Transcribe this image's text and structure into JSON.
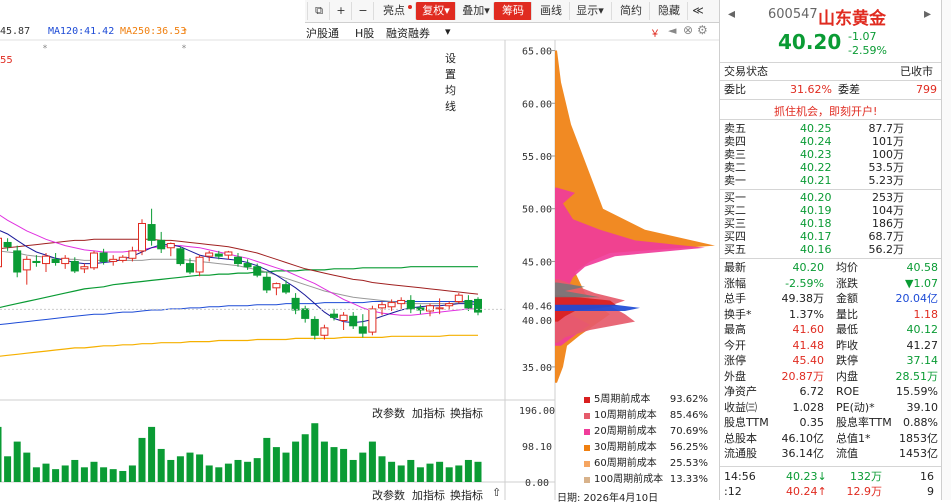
{
  "toolbar": {
    "items": [
      "亮点",
      "复权",
      "叠加",
      "筹码",
      "画线",
      "显示",
      "简约",
      "隐藏"
    ]
  },
  "ma_line": {
    "ma_a": "45.87",
    "ma120": "MA120:41.42",
    "ma250": "MA250:36.53"
  },
  "subnav": {
    "a": "沪股通",
    "b": "H股",
    "c": "融资融券",
    "d": "设置均线"
  },
  "left_edge_val": "55",
  "price_axis": [
    "65.00",
    "60.00",
    "55.00",
    "50.00",
    "45.00",
    "40.46",
    "40.00",
    "35.00"
  ],
  "vol_axis": [
    "196.00",
    "98.10",
    "0.00"
  ],
  "vol_toolbar": {
    "change": "改参数",
    "add": "加指标",
    "swap": "换指标"
  },
  "cost_legend": [
    {
      "label": "5周期前成本",
      "value": "93.62%",
      "color": "#d91f1f"
    },
    {
      "label": "10周期前成本",
      "value": "85.46%",
      "color": "#e65b6b"
    },
    {
      "label": "20周期前成本",
      "value": "70.69%",
      "color": "#f03c9a"
    },
    {
      "label": "30周期前成本",
      "value": "56.25%",
      "color": "#f08010"
    },
    {
      "label": "60周期前成本",
      "value": "25.53%",
      "color": "#f5a561"
    },
    {
      "label": "100周期前成本",
      "value": "13.33%",
      "color": "#d8b28a"
    }
  ],
  "date_label": "日期: 2026年4月10日",
  "stock": {
    "code": "600547",
    "name": "山东黄金",
    "price": "40.20",
    "change": "-1.07",
    "pct": "-2.59%"
  },
  "status": {
    "label": "交易状态",
    "value": "已收市"
  },
  "weibi": {
    "label": "委比",
    "value": "31.62%",
    "label2": "委差",
    "value2": "799"
  },
  "promo": "抓住机会，即刻开户!",
  "asks": [
    {
      "label": "卖五",
      "price": "40.25",
      "vol": "87.7万"
    },
    {
      "label": "卖四",
      "price": "40.24",
      "vol": "101万"
    },
    {
      "label": "卖三",
      "price": "40.23",
      "vol": "100万"
    },
    {
      "label": "卖二",
      "price": "40.22",
      "vol": "53.5万"
    },
    {
      "label": "卖一",
      "price": "40.21",
      "vol": "5.23万"
    }
  ],
  "bids": [
    {
      "label": "买一",
      "price": "40.20",
      "vol": "253万"
    },
    {
      "label": "买二",
      "price": "40.19",
      "vol": "104万"
    },
    {
      "label": "买三",
      "price": "40.18",
      "vol": "186万"
    },
    {
      "label": "买四",
      "price": "40.17",
      "vol": "68.7万"
    },
    {
      "label": "买五",
      "price": "40.16",
      "vol": "56.2万"
    }
  ],
  "stats": [
    {
      "l1": "最新",
      "v1": "40.20",
      "c1": "green",
      "l2": "均价",
      "v2": "40.58",
      "c2": "green"
    },
    {
      "l1": "涨幅",
      "v1": "-2.59%",
      "c1": "green",
      "l2": "涨跌",
      "v2": "▼1.07",
      "c2": "green"
    },
    {
      "l1": "总手",
      "v1": "49.38万",
      "c1": "dark",
      "l2": "金额",
      "v2": "20.04亿",
      "c2": "blue"
    },
    {
      "l1": "换手*",
      "v1": "1.37%",
      "c1": "dark",
      "l2": "量比",
      "v2": "1.18",
      "c2": "red"
    },
    {
      "l1": "最高",
      "v1": "41.60",
      "c1": "red",
      "l2": "最低",
      "v2": "40.12",
      "c2": "green"
    },
    {
      "l1": "今开",
      "v1": "41.48",
      "c1": "red",
      "l2": "昨收",
      "v2": "41.27",
      "c2": "dark"
    },
    {
      "l1": "涨停",
      "v1": "45.40",
      "c1": "red",
      "l2": "跌停",
      "v2": "37.14",
      "c2": "green"
    },
    {
      "l1": "外盘",
      "v1": "20.87万",
      "c1": "red",
      "l2": "内盘",
      "v2": "28.51万",
      "c2": "green"
    },
    {
      "l1": "净资产",
      "v1": "6.72",
      "c1": "dark",
      "l2": "ROE",
      "v2": "15.59%",
      "c2": "dark"
    },
    {
      "l1": "收益㈢",
      "v1": "1.028",
      "c1": "dark",
      "l2": "PE(动)*",
      "v2": "39.10",
      "c2": "dark"
    },
    {
      "l1": "股息TTM",
      "v1": "0.35",
      "c1": "dark",
      "l2": "股息率TTM",
      "v2": "0.88%",
      "c2": "dark"
    },
    {
      "l1": "总股本",
      "v1": "46.10亿",
      "c1": "dark",
      "l2": "总值1*",
      "v2": "1853亿",
      "c2": "dark"
    },
    {
      "l1": "流通股",
      "v1": "36.14亿",
      "c1": "dark",
      "l2": "流值",
      "v2": "1453亿",
      "c2": "dark"
    }
  ],
  "ticks": [
    {
      "time": "14:56",
      "price": "40.23↓",
      "vol": "132万",
      "n": "16",
      "pc": "green",
      "vc": "green"
    },
    {
      "time": ":12",
      "price": "40.24↑",
      "vol": "12.9万",
      "n": "9",
      "pc": "red",
      "vc": "red"
    }
  ],
  "chart_data": {
    "type": "candlestick",
    "y_range": [
      33,
      66
    ],
    "last_price": 40.46,
    "candles": [
      {
        "o": 44.5,
        "h": 47.5,
        "l": 43.6,
        "c": 47.2
      },
      {
        "o": 46.8,
        "h": 47.2,
        "l": 46.0,
        "c": 46.4
      },
      {
        "o": 46.0,
        "h": 46.5,
        "l": 43.5,
        "c": 44.0
      },
      {
        "o": 44.2,
        "h": 45.5,
        "l": 42.8,
        "c": 45.2
      },
      {
        "o": 45.0,
        "h": 45.6,
        "l": 44.5,
        "c": 44.9
      },
      {
        "o": 44.8,
        "h": 45.8,
        "l": 44.0,
        "c": 45.5
      },
      {
        "o": 45.2,
        "h": 45.8,
        "l": 44.6,
        "c": 44.9
      },
      {
        "o": 44.8,
        "h": 45.6,
        "l": 44.3,
        "c": 45.3
      },
      {
        "o": 45.0,
        "h": 45.4,
        "l": 43.9,
        "c": 44.1
      },
      {
        "o": 44.3,
        "h": 44.8,
        "l": 43.9,
        "c": 44.5
      },
      {
        "o": 44.4,
        "h": 46.0,
        "l": 44.2,
        "c": 45.8
      },
      {
        "o": 45.8,
        "h": 46.2,
        "l": 44.7,
        "c": 45.0
      },
      {
        "o": 45.0,
        "h": 45.6,
        "l": 44.6,
        "c": 45.2
      },
      {
        "o": 45.1,
        "h": 45.6,
        "l": 44.9,
        "c": 45.4
      },
      {
        "o": 45.3,
        "h": 46.4,
        "l": 45.0,
        "c": 46.0
      },
      {
        "o": 46.0,
        "h": 49.0,
        "l": 45.6,
        "c": 48.6
      },
      {
        "o": 48.5,
        "h": 50.0,
        "l": 46.5,
        "c": 47.0
      },
      {
        "o": 47.0,
        "h": 47.8,
        "l": 45.8,
        "c": 46.2
      },
      {
        "o": 46.3,
        "h": 46.8,
        "l": 45.5,
        "c": 46.7
      },
      {
        "o": 46.2,
        "h": 46.4,
        "l": 44.6,
        "c": 44.8
      },
      {
        "o": 44.8,
        "h": 45.3,
        "l": 43.8,
        "c": 44.0
      },
      {
        "o": 44.0,
        "h": 45.6,
        "l": 43.6,
        "c": 45.4
      },
      {
        "o": 45.5,
        "h": 46.0,
        "l": 45.0,
        "c": 45.8
      },
      {
        "o": 45.7,
        "h": 46.0,
        "l": 45.2,
        "c": 45.5
      },
      {
        "o": 45.6,
        "h": 46.0,
        "l": 45.2,
        "c": 45.9
      },
      {
        "o": 45.4,
        "h": 45.8,
        "l": 44.5,
        "c": 44.8
      },
      {
        "o": 44.8,
        "h": 45.2,
        "l": 44.2,
        "c": 44.5
      },
      {
        "o": 44.5,
        "h": 44.8,
        "l": 43.5,
        "c": 43.7
      },
      {
        "o": 43.5,
        "h": 44.0,
        "l": 42.0,
        "c": 42.3
      },
      {
        "o": 42.5,
        "h": 43.0,
        "l": 41.8,
        "c": 42.9
      },
      {
        "o": 42.8,
        "h": 43.2,
        "l": 41.9,
        "c": 42.1
      },
      {
        "o": 41.5,
        "h": 42.0,
        "l": 40.0,
        "c": 40.4
      },
      {
        "o": 40.5,
        "h": 40.8,
        "l": 39.2,
        "c": 39.6
      },
      {
        "o": 39.5,
        "h": 39.8,
        "l": 37.6,
        "c": 38.0
      },
      {
        "o": 38.0,
        "h": 39.0,
        "l": 37.6,
        "c": 38.7
      },
      {
        "o": 40.0,
        "h": 40.5,
        "l": 39.4,
        "c": 39.7
      },
      {
        "o": 39.4,
        "h": 40.2,
        "l": 38.5,
        "c": 39.9
      },
      {
        "o": 39.8,
        "h": 40.2,
        "l": 38.6,
        "c": 38.9
      },
      {
        "o": 38.8,
        "h": 40.0,
        "l": 37.8,
        "c": 38.2
      },
      {
        "o": 38.3,
        "h": 40.8,
        "l": 38.0,
        "c": 40.5
      },
      {
        "o": 40.6,
        "h": 41.2,
        "l": 39.9,
        "c": 40.9
      },
      {
        "o": 40.7,
        "h": 41.4,
        "l": 40.3,
        "c": 41.1
      },
      {
        "o": 41.0,
        "h": 41.6,
        "l": 40.5,
        "c": 41.3
      },
      {
        "o": 41.3,
        "h": 41.8,
        "l": 40.1,
        "c": 40.5
      },
      {
        "o": 40.6,
        "h": 40.9,
        "l": 40.0,
        "c": 40.4
      },
      {
        "o": 40.3,
        "h": 41.0,
        "l": 39.8,
        "c": 40.8
      },
      {
        "o": 40.5,
        "h": 41.5,
        "l": 40.0,
        "c": 40.6
      },
      {
        "o": 40.8,
        "h": 41.2,
        "l": 40.4,
        "c": 41.0
      },
      {
        "o": 41.2,
        "h": 42.0,
        "l": 41.0,
        "c": 41.8
      },
      {
        "o": 41.3,
        "h": 41.8,
        "l": 40.3,
        "c": 40.6
      },
      {
        "o": 41.4,
        "h": 41.6,
        "l": 39.9,
        "c": 40.2
      }
    ],
    "ma_short": [
      48.0,
      47.6,
      47.0,
      46.4,
      45.9,
      45.6,
      45.3,
      45.1,
      44.9,
      44.8,
      44.8,
      44.9,
      45.0,
      45.2,
      45.5,
      45.9,
      46.3,
      46.6,
      46.6,
      46.4,
      46.0,
      45.6,
      45.4,
      45.3,
      45.2,
      45.1,
      44.9,
      44.6,
      44.2,
      43.7,
      43.1,
      42.5,
      41.8,
      41.0,
      40.2,
      39.6,
      39.3,
      39.2,
      39.3,
      39.5,
      39.8,
      40.1,
      40.4,
      40.6,
      40.7,
      40.8,
      40.8,
      40.9,
      41.0,
      41.0,
      40.9
    ],
    "ma_mid": [
      49.5,
      48.9,
      48.4,
      47.9,
      47.5,
      47.1,
      46.8,
      46.5,
      46.3,
      46.1,
      46.0,
      45.9,
      45.9,
      45.9,
      46.0,
      46.1,
      46.3,
      46.4,
      46.5,
      46.5,
      46.4,
      46.3,
      46.1,
      45.9,
      45.7,
      45.5,
      45.3,
      45.0,
      44.7,
      44.4,
      44.1,
      43.7,
      43.3,
      42.9,
      42.4,
      41.9,
      41.4,
      41.0,
      40.6,
      40.3,
      40.1,
      40.0,
      39.9,
      39.9,
      40.0,
      40.1,
      40.2,
      40.3,
      40.4,
      40.5,
      40.5
    ],
    "ma_long": [
      46.2,
      46.3,
      46.4,
      46.5,
      46.6,
      46.7,
      46.8,
      46.9,
      47.0,
      47.0,
      47.1,
      47.1,
      47.1,
      47.1,
      47.1,
      47.1,
      47.1,
      47.0,
      47.0,
      46.9,
      46.8,
      46.7,
      46.6,
      46.5,
      46.4,
      46.2,
      46.0,
      45.8,
      45.5,
      45.2,
      44.9,
      44.6,
      44.3,
      44.1,
      43.9,
      43.7,
      43.5,
      43.3,
      43.2,
      43.0,
      42.9,
      42.8,
      42.7,
      42.6,
      42.5,
      42.4,
      42.3,
      42.2,
      42.1,
      42.0,
      41.9
    ],
    "ma_gray": [
      46.0,
      45.9,
      45.8,
      45.6,
      45.5,
      45.4,
      45.3,
      45.2,
      45.2,
      45.1,
      45.1,
      45.1,
      45.1,
      45.1,
      45.1,
      45.1,
      45.2,
      45.2,
      45.2,
      45.2,
      45.1,
      45.0,
      44.9,
      44.8,
      44.7,
      44.6,
      44.4,
      44.2,
      44.0,
      43.7,
      43.4,
      43.1,
      42.8,
      42.5,
      42.2,
      42.0,
      41.8,
      41.6,
      41.5,
      41.4,
      41.3,
      41.2,
      41.1,
      41.0,
      41.0,
      41.0,
      41.0,
      41.0,
      41.1,
      41.1,
      41.1
    ],
    "ma120": [
      40.6,
      40.8,
      41.0,
      41.2,
      41.4,
      41.6,
      41.8,
      42.0,
      42.2,
      42.4,
      42.5,
      42.6,
      42.8,
      42.9,
      43.0,
      43.1,
      43.2,
      43.3,
      43.4,
      43.5,
      43.6,
      43.7,
      43.7,
      43.8,
      43.8,
      43.9,
      43.9,
      44.0,
      44.0,
      44.1,
      44.1,
      44.1,
      44.2,
      44.2,
      44.2,
      44.3,
      44.3,
      44.3,
      44.4,
      44.4,
      44.4,
      44.4,
      44.4,
      44.5,
      44.5,
      44.5,
      44.5,
      44.5,
      44.5,
      44.5,
      44.5
    ],
    "ma_blue": [
      39.0,
      39.1,
      39.2,
      39.3,
      39.4,
      39.5,
      39.6,
      39.7,
      39.8,
      39.9,
      40.0,
      40.0,
      40.1,
      40.2,
      40.2,
      40.3,
      40.4,
      40.4,
      40.5,
      40.5,
      40.6,
      40.6,
      40.7,
      40.7,
      40.8,
      40.8,
      40.8,
      40.9,
      40.9,
      40.9,
      41.0,
      41.0,
      41.0,
      41.0,
      41.1,
      41.1,
      41.1,
      41.1,
      41.1,
      41.2,
      41.2,
      41.2,
      41.2,
      41.2,
      41.2,
      41.2,
      41.2,
      41.2,
      41.2,
      41.2,
      41.2
    ],
    "ma250": [
      36.0,
      36.1,
      36.2,
      36.3,
      36.4,
      36.5,
      36.6,
      36.7,
      36.8,
      36.8,
      36.9,
      37.0,
      37.0,
      37.1,
      37.1,
      37.2,
      37.2,
      37.3,
      37.3,
      37.3,
      37.4,
      37.4,
      37.4,
      37.5,
      37.5,
      37.5,
      37.5,
      37.6,
      37.6,
      37.6,
      37.6,
      37.7,
      37.7,
      37.7,
      37.7,
      37.7,
      37.8,
      37.8,
      37.8,
      37.8,
      37.8,
      37.9,
      37.9,
      37.9,
      37.9,
      37.9,
      37.9,
      38.0,
      38.0,
      38.0,
      38.0
    ],
    "volume_range": [
      0,
      196
    ],
    "volumes": [
      150,
      70,
      110,
      80,
      40,
      50,
      35,
      45,
      60,
      40,
      55,
      40,
      35,
      30,
      45,
      120,
      150,
      90,
      60,
      70,
      80,
      75,
      45,
      40,
      50,
      60,
      55,
      65,
      120,
      95,
      80,
      110,
      130,
      160,
      110,
      95,
      90,
      60,
      80,
      110,
      70,
      55,
      45,
      60,
      40,
      50,
      55,
      40,
      45,
      60,
      55
    ],
    "volume_up": [
      true,
      false,
      false,
      true,
      false,
      true,
      false,
      true,
      false,
      true,
      true,
      false,
      true,
      true,
      true,
      true,
      false,
      false,
      true,
      false,
      false,
      true,
      true,
      false,
      true,
      false,
      false,
      false,
      false,
      true,
      false,
      false,
      false,
      false,
      true,
      false,
      true,
      false,
      false,
      true,
      true,
      true,
      true,
      false,
      false,
      true,
      true,
      true,
      true,
      false,
      false
    ],
    "chip_distribution": {
      "layers": [
        {
          "color": "#f08010",
          "points": [
            [
              65,
              2
            ],
            [
              62,
              6
            ],
            [
              58,
              16
            ],
            [
              55,
              28
            ],
            [
              52,
              40
            ],
            [
              50,
              48
            ],
            [
              48,
              90
            ],
            [
              46.5,
              160
            ],
            [
              45.8,
              55
            ],
            [
              45,
              35
            ],
            [
              44,
              20
            ],
            [
              43,
              25
            ],
            [
              42,
              30
            ],
            [
              41,
              40
            ],
            [
              40,
              55
            ],
            [
              39,
              40
            ],
            [
              38,
              25
            ],
            [
              37,
              12
            ],
            [
              35,
              8
            ],
            [
              33.5,
              2
            ]
          ]
        },
        {
          "color": "#f03c9a",
          "points": [
            [
              52,
              2
            ],
            [
              51.5,
              20
            ],
            [
              50.5,
              8
            ],
            [
              49,
              18
            ],
            [
              48,
              45
            ],
            [
              47,
              80
            ],
            [
              46.3,
              150
            ],
            [
              45.5,
              60
            ],
            [
              44.5,
              30
            ],
            [
              43.5,
              18
            ],
            [
              42,
              10
            ],
            [
              41,
              30
            ],
            [
              40,
              15
            ],
            [
              39,
              35
            ],
            [
              38,
              20
            ],
            [
              37,
              6
            ]
          ]
        },
        {
          "color": "#e65b6b",
          "points": [
            [
              43.3,
              4
            ],
            [
              42,
              40
            ],
            [
              41.3,
              70
            ],
            [
              40.8,
              55
            ],
            [
              40,
              70
            ],
            [
              39.3,
              80
            ],
            [
              38.5,
              35
            ],
            [
              37.8,
              10
            ],
            [
              37.3,
              3
            ]
          ]
        },
        {
          "color": "#d91f1f",
          "points": [
            [
              41.8,
              3
            ],
            [
              41.3,
              55
            ],
            [
              40.8,
              62
            ],
            [
              40.3,
              20
            ],
            [
              39.8,
              10
            ],
            [
              39.3,
              3
            ]
          ]
        },
        {
          "color": "#1d4bd6",
          "points": [
            [
              40.9,
              60
            ],
            [
              40.6,
              85
            ],
            [
              40.3,
              70
            ]
          ]
        },
        {
          "color": "#777777",
          "points": [
            [
              43.0,
              2
            ],
            [
              42.6,
              30
            ],
            [
              42.2,
              10
            ],
            [
              41.6,
              45
            ]
          ]
        }
      ]
    }
  }
}
